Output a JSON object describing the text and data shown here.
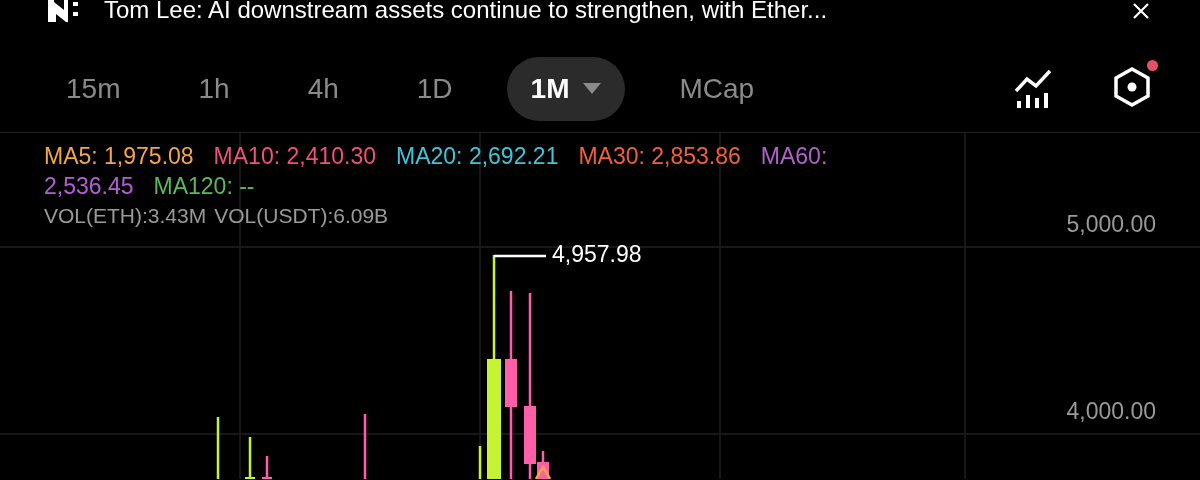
{
  "banner": {
    "text": "Tom Lee: AI downstream assets continue to strengthen, with Ether..."
  },
  "tabs": [
    {
      "label": "15m",
      "selected": false,
      "menu": false
    },
    {
      "label": "1h",
      "selected": false,
      "menu": false
    },
    {
      "label": "4h",
      "selected": false,
      "menu": false
    },
    {
      "label": "1D",
      "selected": false,
      "menu": false
    },
    {
      "label": "1M",
      "selected": true,
      "menu": true
    },
    {
      "label": "MCap",
      "selected": false,
      "menu": false
    }
  ],
  "settings": {
    "notification": true
  },
  "indicators": [
    {
      "name": "MA5:",
      "reading": "1,975.08",
      "color": "#f5a54a"
    },
    {
      "name": "MA10:",
      "reading": "2,410.30",
      "color": "#f0507a"
    },
    {
      "name": "MA20:",
      "reading": "2,692.21",
      "color": "#3ec6d8"
    },
    {
      "name": "MA30:",
      "reading": "2,853.86",
      "color": "#f0603a"
    },
    {
      "name": "MA60:",
      "reading": "2,536.45",
      "color": "#b45fd0"
    },
    {
      "name": "MA120:",
      "reading": "--",
      "color": "#5cb85c"
    }
  ],
  "volume": [
    "VOL(ETH):3.43M",
    "VOL(USDT):6.09B"
  ],
  "chart": {
    "y_labels": [
      "5,000.00",
      "4,000.00"
    ],
    "high_label": "4,957.98"
  }
}
